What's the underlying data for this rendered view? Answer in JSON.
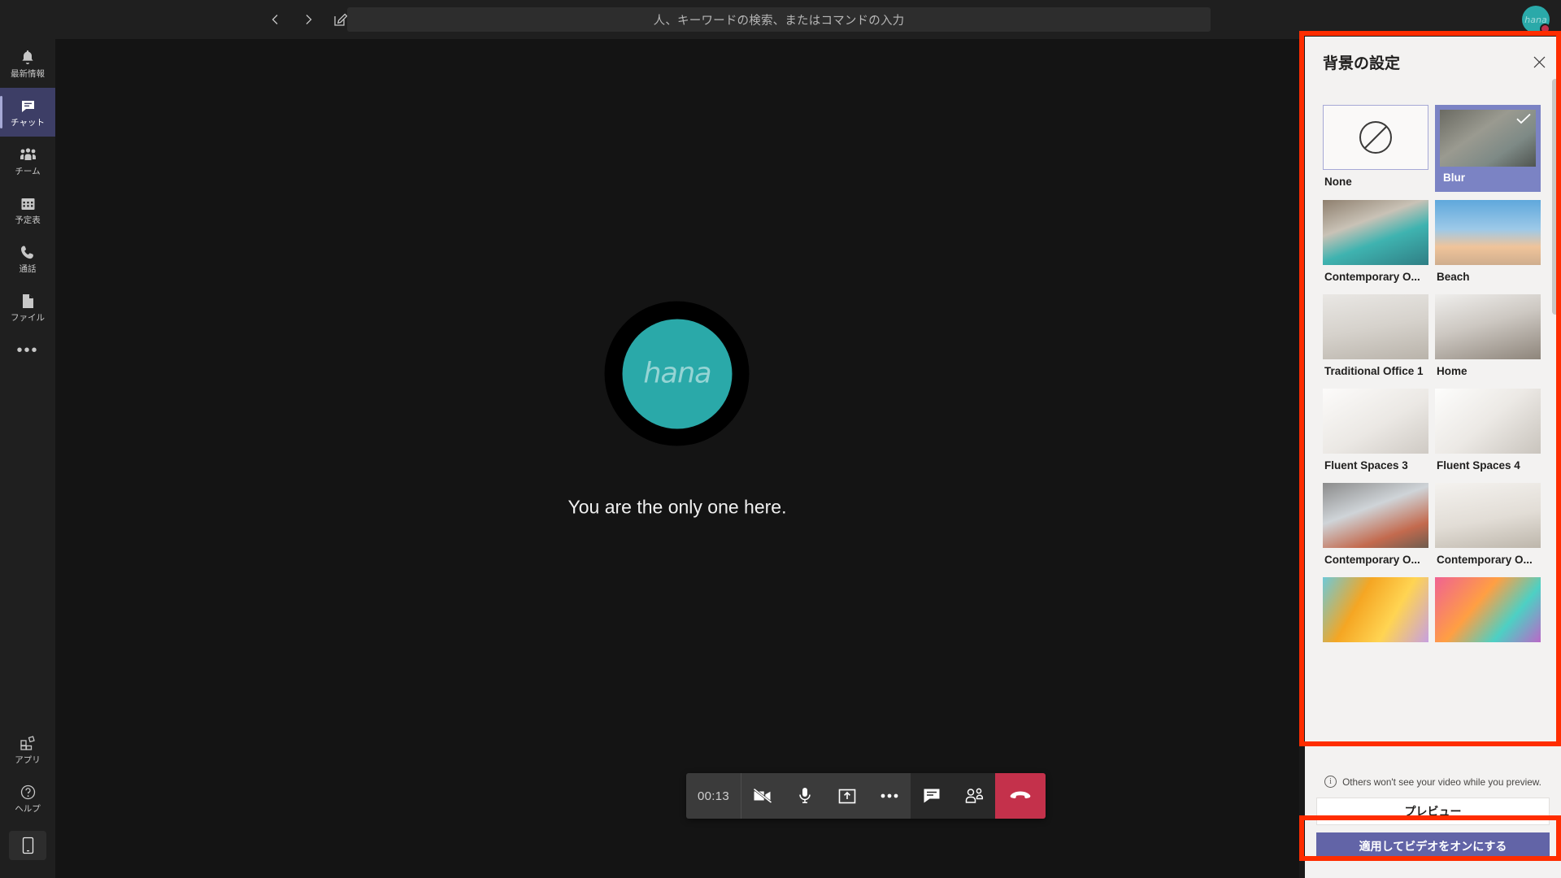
{
  "topbar": {
    "back_icon": "chevron-left-icon",
    "forward_icon": "chevron-right-icon",
    "compose_icon": "compose-icon",
    "search_placeholder": "人、キーワードの検索、またはコマンドの入力",
    "avatar_initials": "hana",
    "presence_status": "busy",
    "presence_color": "#c4314b"
  },
  "rail": {
    "items": [
      {
        "label": "最新情報",
        "icon": "bell-icon",
        "active": false
      },
      {
        "label": "チャット",
        "icon": "chat-icon",
        "active": true
      },
      {
        "label": "チーム",
        "icon": "teams-icon",
        "active": false
      },
      {
        "label": "予定表",
        "icon": "calendar-icon",
        "active": false
      },
      {
        "label": "通話",
        "icon": "phone-icon",
        "active": false
      },
      {
        "label": "ファイル",
        "icon": "file-icon",
        "active": false
      }
    ],
    "more_label": "•••",
    "bottom_items": [
      {
        "label": "アプリ",
        "icon": "apps-icon"
      },
      {
        "label": "ヘルプ",
        "icon": "help-icon"
      }
    ],
    "download_icon": "mobile-phone-icon"
  },
  "stage": {
    "avatar_initials": "hana",
    "avatar_color": "#2aa9a9",
    "alone_message": "You are the only one here."
  },
  "callbar": {
    "timer": "00:13",
    "buttons": [
      {
        "name": "camera-off-button",
        "icon": "video-off-icon"
      },
      {
        "name": "microphone-button",
        "icon": "microphone-icon"
      },
      {
        "name": "share-screen-button",
        "icon": "share-screen-icon"
      },
      {
        "name": "more-options-button",
        "icon": "ellipsis-icon"
      },
      {
        "name": "chat-button",
        "icon": "chat-bubble-icon"
      },
      {
        "name": "participants-button",
        "icon": "people-icon"
      }
    ],
    "hangup": {
      "name": "hangup-button",
      "icon": "hangup-icon",
      "color": "#c4314b"
    }
  },
  "panel": {
    "title": "背景の設定",
    "close_icon": "close-icon",
    "selected_background": "Blur",
    "accent_color": "#6264a7",
    "selected_tile_color": "#7b83c4",
    "backgrounds": [
      {
        "label": "None",
        "type": "none",
        "selected": false
      },
      {
        "label": "Blur",
        "type": "blur",
        "selected": true
      },
      {
        "label": "Contemporary O...",
        "type": "image",
        "selected": false
      },
      {
        "label": "Beach",
        "type": "image",
        "selected": false
      },
      {
        "label": "Traditional Office 1",
        "type": "image",
        "selected": false
      },
      {
        "label": "Home",
        "type": "image",
        "selected": false
      },
      {
        "label": "Fluent Spaces 3",
        "type": "image",
        "selected": false
      },
      {
        "label": "Fluent Spaces 4",
        "type": "image",
        "selected": false
      },
      {
        "label": "Contemporary O...",
        "type": "image",
        "selected": false
      },
      {
        "label": "Contemporary O...",
        "type": "image",
        "selected": false
      },
      {
        "label": "",
        "type": "image",
        "selected": false
      },
      {
        "label": "",
        "type": "image",
        "selected": false
      }
    ],
    "footer": {
      "info_icon": "info-icon",
      "info_text": "Others won't see your video while you preview.",
      "preview_label": "プレビュー",
      "apply_label": "適用してビデオをオンにする"
    }
  },
  "annotations": {
    "highlight_color": "#ff2d00",
    "boxes": [
      "background-gallery",
      "apply-and-turn-on-video-button"
    ]
  }
}
